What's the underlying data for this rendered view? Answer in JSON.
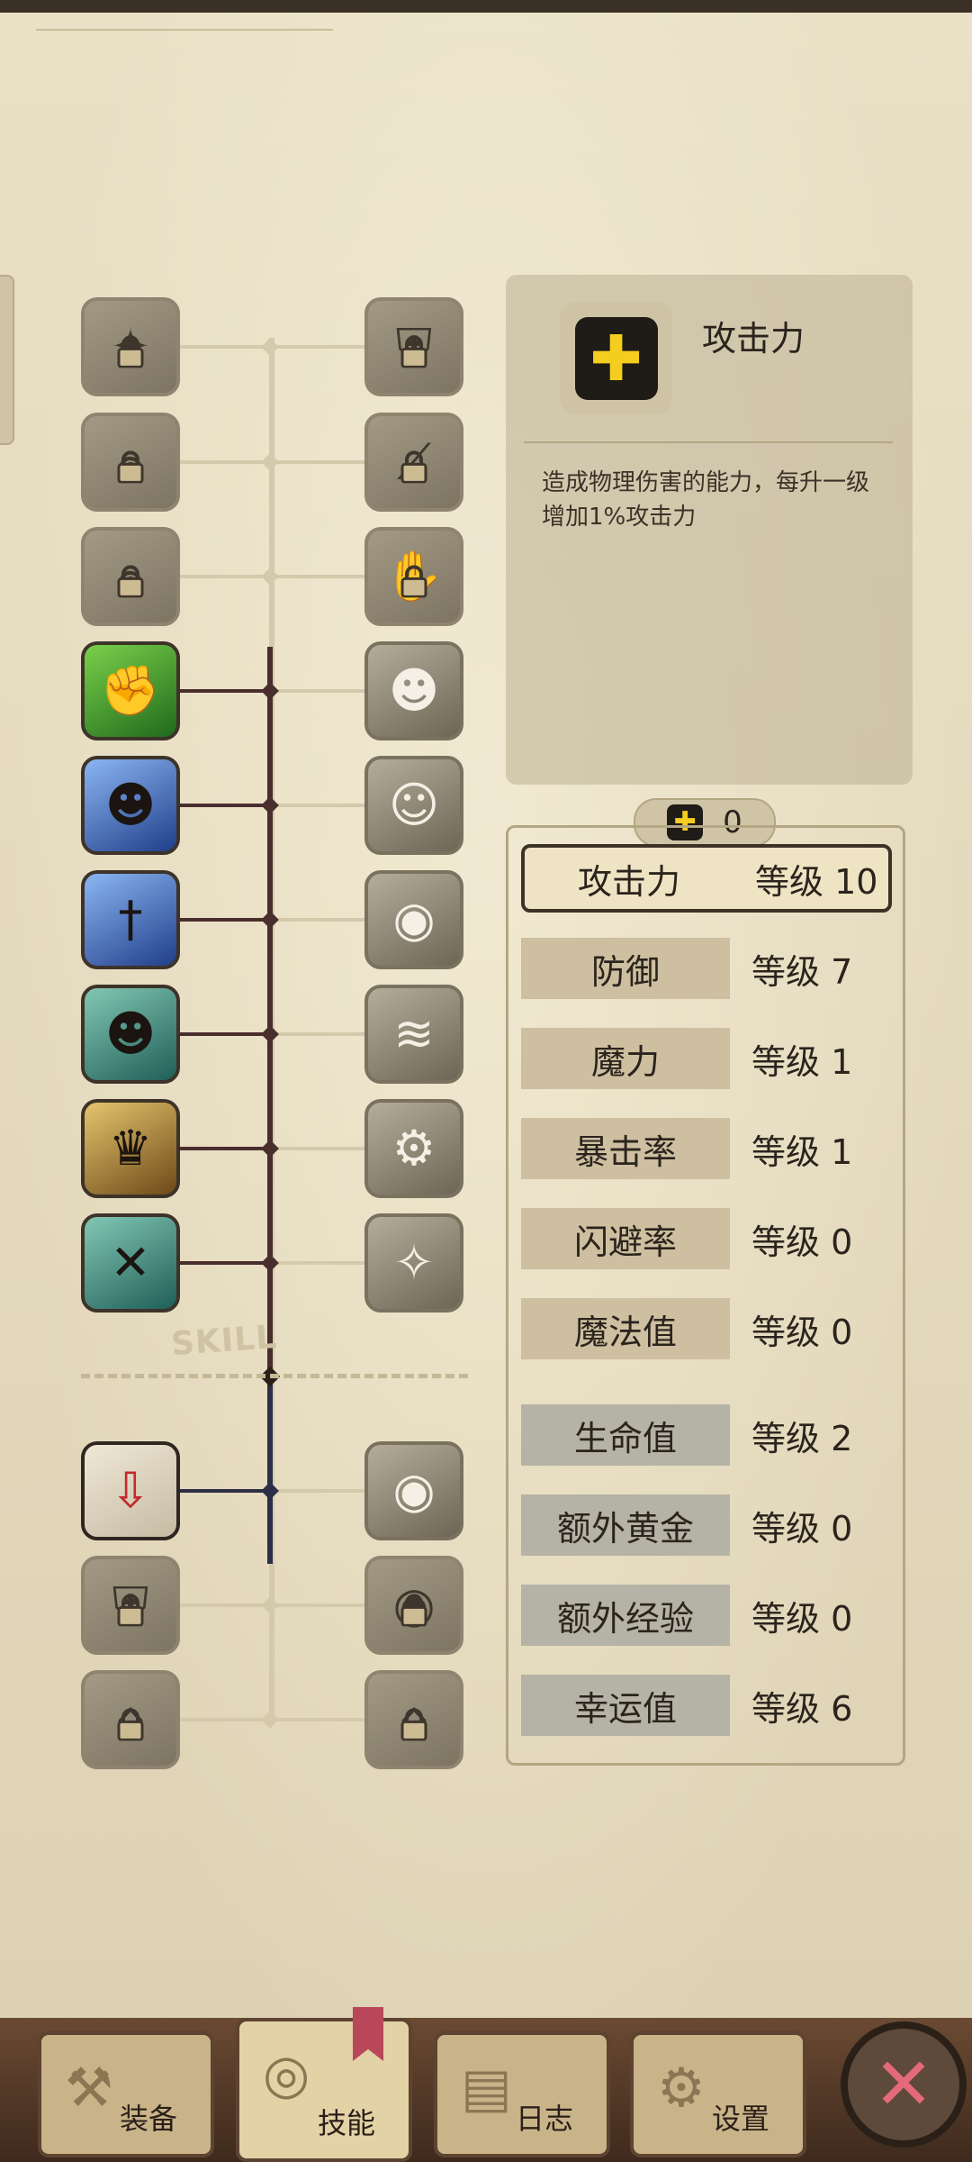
{
  "skill_tree": {
    "divider_label": "SKILL",
    "left_column": [
      {
        "icon": "cracked-stone-icon",
        "state": "locked"
      },
      {
        "icon": "tornado-icon",
        "state": "locked"
      },
      {
        "icon": "swirl-icon",
        "state": "locked"
      },
      {
        "icon": "flexing-arm-icon",
        "state": "active",
        "theme": "green"
      },
      {
        "icon": "spinning-hero-icon",
        "state": "active",
        "theme": "blue"
      },
      {
        "icon": "sword-icon",
        "state": "active",
        "theme": "blue"
      },
      {
        "icon": "dashing-hero-icon",
        "state": "active",
        "theme": "teal"
      },
      {
        "icon": "golden-warrior-icon",
        "state": "active",
        "theme": "gold"
      },
      {
        "icon": "crossed-blades-icon",
        "state": "active",
        "theme": "teal"
      },
      {
        "icon": "red-trap-icon",
        "state": "active",
        "theme": "red"
      },
      {
        "icon": "shield-crest-icon",
        "state": "locked"
      },
      {
        "icon": "trap-cage-icon",
        "state": "locked"
      }
    ],
    "right_column": [
      {
        "icon": "shield-badge-icon",
        "state": "locked"
      },
      {
        "icon": "slash-icon",
        "state": "locked"
      },
      {
        "icon": "broken-hand-icon",
        "state": "locked"
      },
      {
        "icon": "charging-hero-icon",
        "state": "inactive"
      },
      {
        "icon": "muscle-pose-icon",
        "state": "inactive"
      },
      {
        "icon": "eye-burst-icon",
        "state": "inactive"
      },
      {
        "icon": "wind-slash-icon",
        "state": "inactive"
      },
      {
        "icon": "cog-ring-icon",
        "state": "inactive"
      },
      {
        "icon": "sparkle-hero-icon",
        "state": "inactive"
      },
      {
        "icon": "watching-eye-icon",
        "state": "inactive"
      },
      {
        "icon": "eye-lock-icon",
        "state": "locked"
      },
      {
        "icon": "hooded-lock-icon",
        "state": "locked"
      }
    ]
  },
  "info_panel": {
    "icon": "plus-icon",
    "title": "攻击力",
    "description": "造成物理伤害的能力，每升一级增加1%攻击力"
  },
  "points": {
    "icon": "plus-icon",
    "value": "0"
  },
  "stats": [
    {
      "name": "攻击力",
      "level": "等级 10",
      "selected": true,
      "group": "tan"
    },
    {
      "name": "防御",
      "level": "等级 7",
      "group": "tan"
    },
    {
      "name": "魔力",
      "level": "等级 1",
      "group": "tan"
    },
    {
      "name": "暴击率",
      "level": "等级 1",
      "group": "tan"
    },
    {
      "name": "闪避率",
      "level": "等级 0",
      "group": "tan"
    },
    {
      "name": "魔法值",
      "level": "等级 0",
      "group": "tan"
    },
    {
      "name": "生命值",
      "level": "等级 2",
      "group": "blue"
    },
    {
      "name": "额外黄金",
      "level": "等级 0",
      "group": "blue"
    },
    {
      "name": "额外经验",
      "level": "等级 0",
      "group": "blue"
    },
    {
      "name": "幸运值",
      "level": "等级 6",
      "group": "blue"
    }
  ],
  "nav": {
    "equipment": "装备",
    "skills": "技能",
    "log": "日志",
    "settings": "设置",
    "active": "skills",
    "close_icon": "close-icon"
  },
  "colors": {
    "accent_yellow": "#f5cd1e",
    "tree_line_active": "#4a2e2e",
    "tree_line_lower": "#2c2f45",
    "close_red": "#e46a7a"
  }
}
